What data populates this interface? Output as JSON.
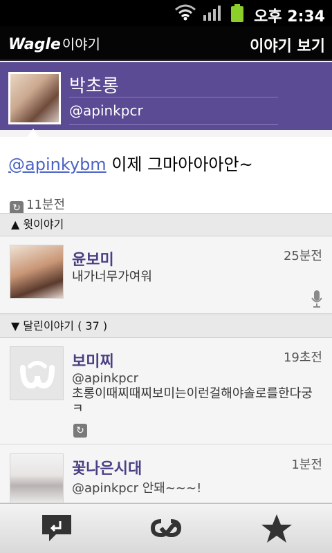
{
  "status": {
    "time": "오후 2:34"
  },
  "appbar": {
    "logo_main": "Wagle",
    "logo_sub": "이야기",
    "title": "이야기 보기"
  },
  "profile": {
    "name": "박초롱",
    "handle": "@apinkpcr"
  },
  "message": {
    "mention": "@apinkybm",
    "text": " 이제 그마아아아안~",
    "time": "11분전"
  },
  "sections": {
    "parent": "▲ 윗이야기",
    "replies": "▼ 달린이야기 ( 37 )"
  },
  "parent_item": {
    "name": "윤보미",
    "time": "25분전",
    "text": "내가너무가여워"
  },
  "replies": [
    {
      "name": "보미찌",
      "time": "19초전",
      "handle": "@apinkpcr",
      "text": "초롱이때찌때찌보미는이런걸해야솔로를한다궁ㅋ"
    },
    {
      "name": "꽃나은시대",
      "time": "1분전",
      "handle": "@apinkpcr 안돼~~~!"
    }
  ],
  "icons": {
    "toolbar": [
      "reply-icon",
      "retweet-icon",
      "favorite-icon"
    ]
  }
}
